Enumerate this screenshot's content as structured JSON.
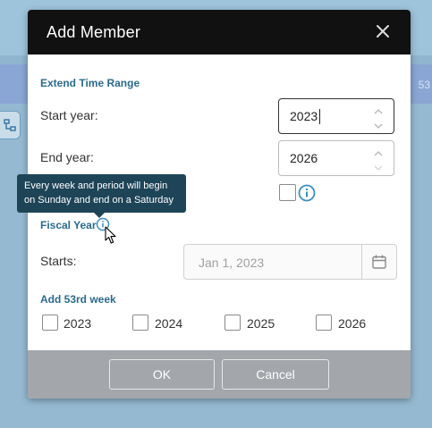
{
  "background": {
    "band_text": "53"
  },
  "dialog": {
    "title": "Add Member",
    "close_icon": "close-icon",
    "extend_section": "Extend Time Range",
    "start_year_label": "Start year:",
    "start_year_value": "2023",
    "end_year_label": "End year:",
    "end_year_value": "2026",
    "fiscal_year_label": "Fiscal Year",
    "tooltip_line1": "Every week and period will begin",
    "tooltip_line2": "on Sunday and end on a Saturday",
    "starts_label": "Starts:",
    "starts_value": "Jan 1, 2023",
    "add53_section": "Add 53rd week",
    "week_years": [
      "2023",
      "2024",
      "2025",
      "2026"
    ],
    "ok_label": "OK",
    "cancel_label": "Cancel"
  },
  "colors": {
    "header": "#111111",
    "section_title": "#2b6a8e",
    "info_icon": "#3a8fc0",
    "tooltip": "#1e4457",
    "footer": "#a3a6ab"
  }
}
